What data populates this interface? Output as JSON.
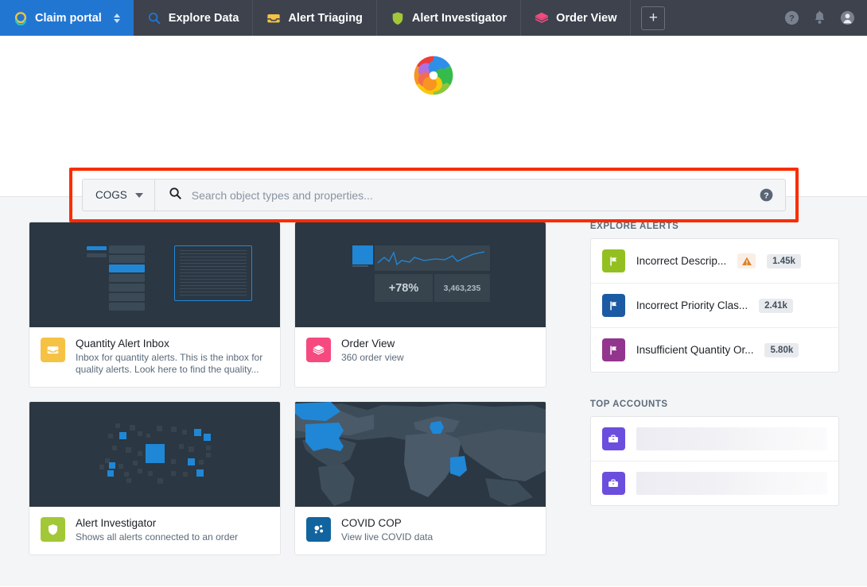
{
  "nav": {
    "tabs": [
      {
        "label": "Claim portal",
        "icon": "ring-logo-icon",
        "active": true,
        "has_caret": true
      },
      {
        "label": "Explore Data",
        "icon": "magnifier-icon",
        "active": false
      },
      {
        "label": "Alert Triaging",
        "icon": "inbox-icon",
        "active": false
      },
      {
        "label": "Alert Investigator",
        "icon": "shield-icon",
        "active": false
      },
      {
        "label": "Order View",
        "icon": "layers-icon",
        "active": false
      }
    ],
    "add_tab_label": "+",
    "right_icons": [
      "help-icon",
      "notifications-bell-icon",
      "user-avatar-icon"
    ]
  },
  "hero": {
    "logo_icon": "pinwheel-logo-icon"
  },
  "search": {
    "scope_label": "COGS",
    "placeholder": "Search object types and properties...",
    "value": "",
    "help_icon": "help-icon",
    "search_icon": "search-icon",
    "highlight_color": "#fb2d00"
  },
  "cards": [
    {
      "title": "Quantity Alert Inbox",
      "description": "Inbox for quantity alerts. This is the inbox for quality alerts. Look here to find the quality...",
      "icon": "inbox-icon",
      "icon_color": "#f5c243",
      "thumb": "inbox-art"
    },
    {
      "title": "Order View",
      "description": "360 order view",
      "icon": "layers-icon",
      "icon_color": "#f5497f",
      "thumb": "chart-art",
      "thumb_stat_percent": "+78%",
      "thumb_stat_value": "3,463,235"
    },
    {
      "title": "Alert Investigator",
      "description": "Shows all alerts connected to an order",
      "icon": "shield-icon",
      "icon_color": "#a2c837",
      "thumb": "graph-art"
    },
    {
      "title": "COVID COP",
      "description": "View live COVID data",
      "icon": "molecule-icon",
      "icon_color": "#12649e",
      "thumb": "map-art"
    }
  ],
  "explore_alerts": {
    "heading": "EXPLORE ALERTS",
    "rows": [
      {
        "label": "Incorrect Descrip...",
        "icon": "flag-icon",
        "icon_color": "#93c020",
        "warning": true,
        "warning_icon": "warning-triangle-icon",
        "count": "1.45k"
      },
      {
        "label": "Incorrect Priority Clas...",
        "icon": "flag-icon",
        "icon_color": "#1c5ba3",
        "warning": false,
        "count": "2.41k"
      },
      {
        "label": "Insufficient Quantity Or...",
        "icon": "flag-icon",
        "icon_color": "#93358e",
        "warning": false,
        "count": "5.80k"
      }
    ]
  },
  "top_accounts": {
    "heading": "TOP ACCOUNTS",
    "rows": [
      {
        "icon": "briefcase-icon",
        "icon_color": "#6b4ede",
        "label": ""
      },
      {
        "icon": "briefcase-icon",
        "icon_color": "#6b4ede",
        "label": ""
      }
    ]
  }
}
